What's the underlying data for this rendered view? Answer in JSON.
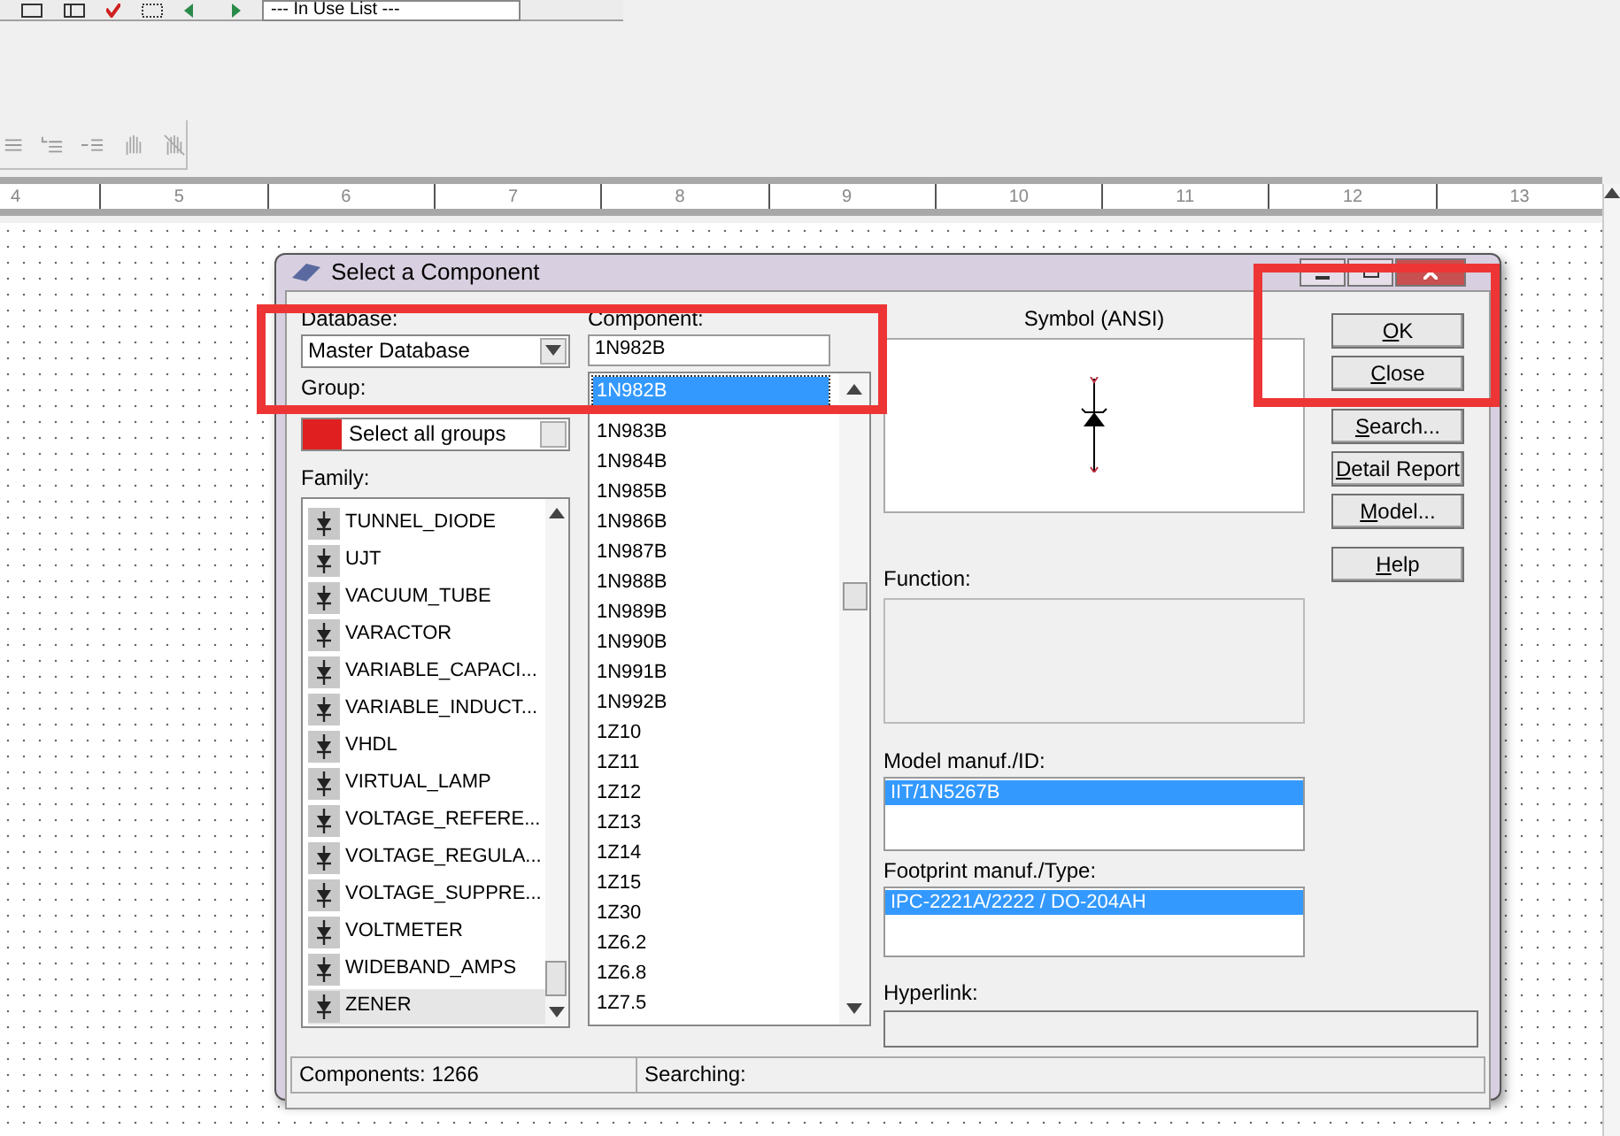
{
  "toolbar": {
    "dropdown": "--- In Use List ---"
  },
  "ruler": [
    "4",
    "5",
    "6",
    "7",
    "8",
    "9",
    "10",
    "11",
    "12",
    "13"
  ],
  "dialog": {
    "title": "Select a Component",
    "database": {
      "label": "Database:",
      "value": "Master Database"
    },
    "group": {
      "label": "Group:",
      "value": "Select all groups"
    },
    "family": {
      "label": "Family:",
      "items": [
        {
          "label": "TUNNEL_DIODE",
          "selected": false
        },
        {
          "label": "UJT",
          "selected": false
        },
        {
          "label": "VACUUM_TUBE",
          "selected": false
        },
        {
          "label": "VARACTOR",
          "selected": false
        },
        {
          "label": "VARIABLE_CAPACI...",
          "selected": false
        },
        {
          "label": "VARIABLE_INDUCT...",
          "selected": false
        },
        {
          "label": "VHDL",
          "selected": false
        },
        {
          "label": "VIRTUAL_LAMP",
          "selected": false
        },
        {
          "label": "VOLTAGE_REFERE...",
          "selected": false
        },
        {
          "label": "VOLTAGE_REGULA...",
          "selected": false
        },
        {
          "label": "VOLTAGE_SUPPRE...",
          "selected": false
        },
        {
          "label": "VOLTMETER",
          "selected": false
        },
        {
          "label": "WIDEBAND_AMPS",
          "selected": false
        },
        {
          "label": "ZENER",
          "selected": true
        }
      ]
    },
    "component": {
      "label": "Component:",
      "value": "1N982B",
      "items": [
        {
          "label": "1N982B",
          "selected": true
        },
        {
          "label": "1N983B",
          "selected": false
        },
        {
          "label": "1N984B",
          "selected": false
        },
        {
          "label": "1N985B",
          "selected": false
        },
        {
          "label": "1N986B",
          "selected": false
        },
        {
          "label": "1N987B",
          "selected": false
        },
        {
          "label": "1N988B",
          "selected": false
        },
        {
          "label": "1N989B",
          "selected": false
        },
        {
          "label": "1N990B",
          "selected": false
        },
        {
          "label": "1N991B",
          "selected": false
        },
        {
          "label": "1N992B",
          "selected": false
        },
        {
          "label": "1Z10",
          "selected": false
        },
        {
          "label": "1Z11",
          "selected": false
        },
        {
          "label": "1Z12",
          "selected": false
        },
        {
          "label": "1Z13",
          "selected": false
        },
        {
          "label": "1Z14",
          "selected": false
        },
        {
          "label": "1Z15",
          "selected": false
        },
        {
          "label": "1Z30",
          "selected": false
        },
        {
          "label": "1Z6.2",
          "selected": false
        },
        {
          "label": "1Z6.8",
          "selected": false
        },
        {
          "label": "1Z7.5",
          "selected": false
        }
      ]
    },
    "symbol": {
      "title": "Symbol (ANSI)"
    },
    "function": {
      "label": "Function:"
    },
    "model": {
      "label": "Model manuf./ID:",
      "items": [
        {
          "label": "IIT/1N5267B",
          "selected": true
        }
      ]
    },
    "footprint": {
      "label": "Footprint manuf./Type:",
      "items": [
        {
          "label": "IPC-2221A/2222 / DO-204AH",
          "selected": true
        }
      ]
    },
    "hyperlink": {
      "label": "Hyperlink:"
    },
    "buttons": [
      {
        "label": "OK"
      },
      {
        "label": "Close"
      },
      {
        "label": "Search..."
      },
      {
        "label": "Detail Report"
      },
      {
        "label": "Model..."
      },
      {
        "label": "Help"
      }
    ],
    "status": [
      "Components: 1266",
      "Searching:"
    ]
  },
  "annotations": [
    {
      "kind": "rectangle",
      "color": "#ee3535"
    },
    {
      "kind": "rectangle",
      "color": "#ee3535"
    }
  ]
}
